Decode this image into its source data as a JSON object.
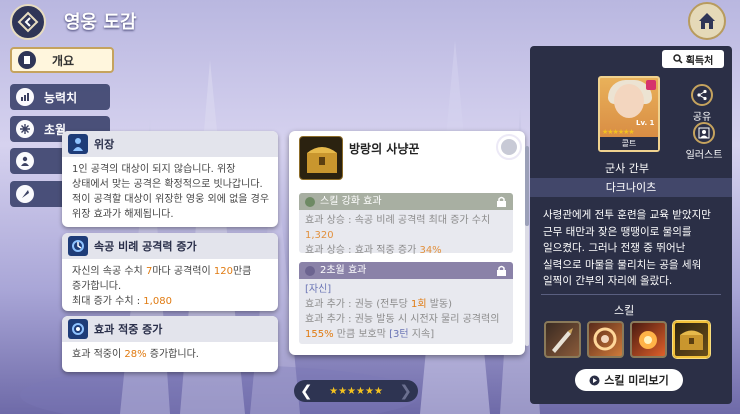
{
  "header": {
    "title": "영웅 도감"
  },
  "tabs": [
    {
      "label": "개요",
      "icon": "document-icon",
      "active": true
    },
    {
      "label": "능력치",
      "icon": "stats-icon",
      "active": false
    },
    {
      "label": "초월",
      "icon": "snowflake-icon",
      "active": false
    },
    {
      "label": "",
      "icon": "person-icon",
      "active": false
    },
    {
      "label": "",
      "icon": "feather-icon",
      "active": false
    }
  ],
  "tooltips": [
    {
      "title": "위장",
      "icon": "disguise-icon",
      "lines": [
        "1인 공격의 대상이 되지 않습니다. 위장",
        "상태에서 맞는 공격은 확정적으로 빗나갑니다.",
        "적이 공격할 대상이 위장한 영웅 외에 없을 경우",
        "위장 효과가 해제됩니다."
      ]
    },
    {
      "title": "속공 비례 공격력 증가",
      "icon": "speed-attack-icon",
      "line1_pre": "자신의 속공 수치 ",
      "line1_a": "7",
      "line1_mid": "마다 공격력이 ",
      "line1_b": "120",
      "line1_post": "만큼",
      "line2": "증가합니다.",
      "line3_pre": "최대 증가 수치 : ",
      "line3_val": "1,080"
    },
    {
      "title": "효과 적중 증가",
      "icon": "accuracy-icon",
      "line_pre": "효과 적중이 ",
      "line_val": "28%",
      "line_post": " 증가합니다."
    }
  ],
  "ability": {
    "title": "방랑의 사냥꾼",
    "icon": "treasure-chest-icon",
    "sections": [
      {
        "header": "스킬 강화 효과",
        "lines": [
          "효과 상승 : 속공 비례 공격력 최대 증가 수치",
          "1,320",
          "효과 상승 : 효과 적중 증가 ",
          "34%"
        ]
      },
      {
        "header": "2초월 효과",
        "tag": "[자신]",
        "line1_pre": "효과 추가 : 권능 (전투당 ",
        "line1_hl": "1회",
        "line1_post": " 발동)",
        "line2": "효과 추가 : 권능 발동 시 시전자 물리 공격력의",
        "line3_hl": "155%",
        "line3_mid": " 만큼 보호막 ",
        "line3_tag": "[3턴",
        "line3_post": " 지속]"
      }
    ]
  },
  "pager": {
    "stars": 6
  },
  "hero": {
    "acquire_label": "획득처",
    "name": "콜트",
    "level": "Lv. 1",
    "stars": "★★★★★★",
    "share_label": "공유",
    "illust_label": "일러스트",
    "class": "군사 간부",
    "faction": "다크나이츠",
    "bio": [
      "사령관에게 전투 훈련을 교육 받았지만",
      "근무 태만과 잦은 땡땡이로 물의를",
      "일으켰다. 그러나 전쟁 중 뛰어난",
      "실력으로 마물을 물리치는 공을 세워",
      "일찍이 간부의 자리에 올랐다."
    ],
    "skill_label": "스킬",
    "skills": [
      "dagger-skill-icon",
      "spin-slash-skill-icon",
      "fire-burst-skill-icon",
      "treasure-chest-skill-icon"
    ],
    "preview_label": "스킬 미리보기"
  },
  "colors": {
    "accent_gold": "#c5a35e",
    "highlight_orange": "#e07b12",
    "panel_dark": "#2b2f46"
  }
}
